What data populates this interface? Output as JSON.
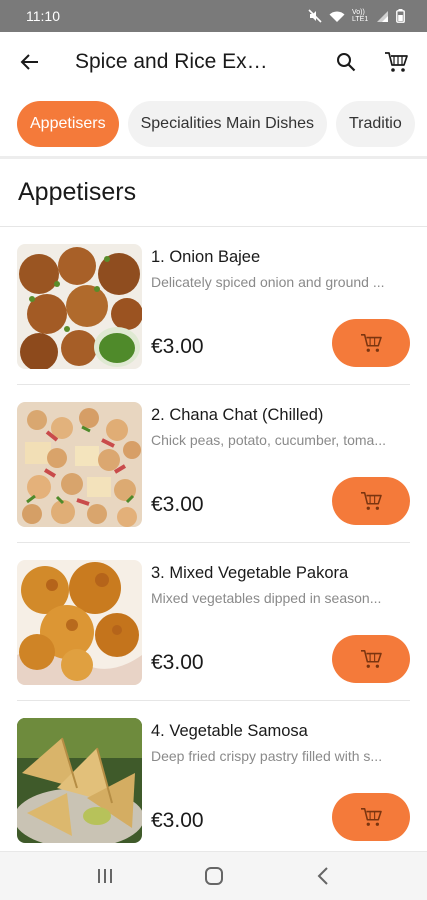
{
  "status_bar": {
    "time": "11:10",
    "network_label": "Vo)) LTE1"
  },
  "app_bar": {
    "title": "Spice and Rice Ex…"
  },
  "categories": [
    {
      "label": "Appetisers",
      "active": true
    },
    {
      "label": "Specialities Main Dishes",
      "active": false
    },
    {
      "label": "Traditio",
      "active": false
    }
  ],
  "section": {
    "title": "Appetisers"
  },
  "items": [
    {
      "name": "1. Onion Bajee",
      "description": "Delicately spiced onion and ground ...",
      "price": "€3.00"
    },
    {
      "name": "2. Chana Chat (Chilled)",
      "description": "Chick peas, potato, cucumber, toma...",
      "price": "€3.00"
    },
    {
      "name": "3. Mixed Vegetable Pakora",
      "description": "Mixed vegetables dipped in season...",
      "price": "€3.00"
    },
    {
      "name": "4. Vegetable Samosa",
      "description": "Deep fried crispy pastry filled with s...",
      "price": "€3.00"
    }
  ],
  "colors": {
    "accent": "#f47a3a",
    "chip_bg": "#f2f2f2",
    "status_bar": "#7a7a7a"
  },
  "icons": {
    "back": "arrow-left-icon",
    "search": "search-icon",
    "cart": "cart-icon",
    "add_to_cart": "cart-icon",
    "nav_recents": "recents-icon",
    "nav_home": "home-icon",
    "nav_back": "chevron-left-icon"
  }
}
